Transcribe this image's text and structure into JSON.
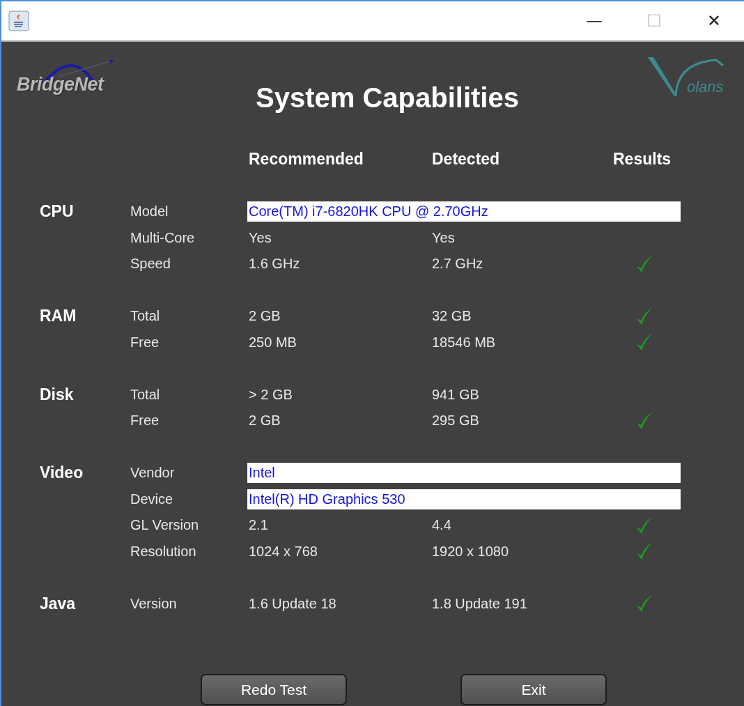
{
  "window": {
    "buttons": [
      "—",
      "☐",
      "✕"
    ]
  },
  "logos": {
    "left": "BridgeNet",
    "right": "olans"
  },
  "title": "System Capabilities",
  "columns": [
    "Recommended",
    "Detected",
    "Results"
  ],
  "groups": [
    {
      "name": "CPU",
      "rows": [
        {
          "kind": "field",
          "label": "Model",
          "value": "Core(TM) i7-6820HK CPU @ 2.70GHz"
        },
        {
          "kind": "values",
          "label": "Multi-Core",
          "recommended": "Yes",
          "detected": "Yes",
          "pass": false
        },
        {
          "kind": "values",
          "label": "Speed",
          "recommended": "1.6 GHz",
          "detected": "2.7 GHz",
          "pass": true
        }
      ]
    },
    {
      "name": "RAM",
      "rows": [
        {
          "kind": "values",
          "label": "Total",
          "recommended": "2 GB",
          "detected": "32 GB",
          "pass": true
        },
        {
          "kind": "values",
          "label": "Free",
          "recommended": "250 MB",
          "detected": "18546 MB",
          "pass": true
        }
      ]
    },
    {
      "name": "Disk",
      "rows": [
        {
          "kind": "values",
          "label": "Total",
          "recommended": "> 2 GB",
          "detected": "941 GB",
          "pass": false
        },
        {
          "kind": "values",
          "label": "Free",
          "recommended": "2 GB",
          "detected": "295 GB",
          "pass": true
        }
      ]
    },
    {
      "name": "Video",
      "rows": [
        {
          "kind": "field",
          "label": "Vendor",
          "value": "Intel"
        },
        {
          "kind": "field",
          "label": "Device",
          "value": "Intel(R) HD Graphics 530"
        },
        {
          "kind": "values",
          "label": "GL Version",
          "recommended": "2.1",
          "detected": "4.4",
          "pass": true
        },
        {
          "kind": "values",
          "label": "Resolution",
          "recommended": "1024 x 768",
          "detected": "1920 x 1080",
          "pass": true
        }
      ]
    },
    {
      "name": "Java",
      "rows": [
        {
          "kind": "values",
          "label": "Version",
          "recommended": "1.6 Update 18",
          "detected": "1.8 Update 191",
          "pass": true
        }
      ]
    }
  ],
  "actions": [
    "Redo Test",
    "Exit"
  ]
}
